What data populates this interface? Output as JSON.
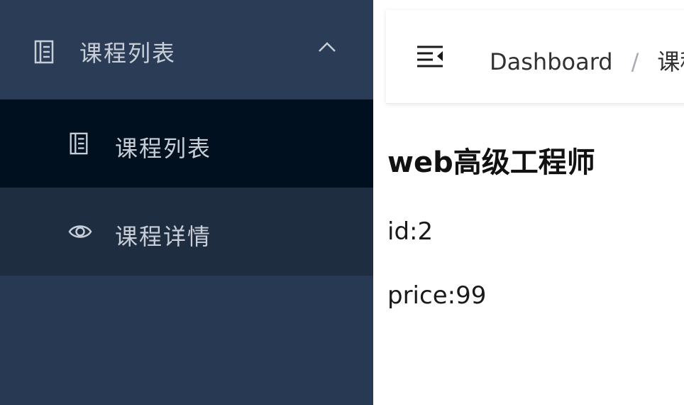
{
  "sidebar": {
    "submenu": {
      "label": "课程列表",
      "icon": "document-icon",
      "expanded": true
    },
    "items": [
      {
        "label": "课程列表",
        "icon": "document-icon",
        "active": true
      },
      {
        "label": "课程详情",
        "icon": "eye-icon",
        "active": false
      }
    ]
  },
  "header": {
    "breadcrumb": [
      "Dashboard",
      "/",
      "课程"
    ]
  },
  "course": {
    "title": "web高级工程师",
    "id_text": "id:2",
    "price_text": "price:99"
  },
  "colors": {
    "sidebar_bg": "#273953",
    "active_item_bg": "#01101f",
    "hover_item_bg": "#1f2d41",
    "sidebar_text": "#c8ced7"
  }
}
